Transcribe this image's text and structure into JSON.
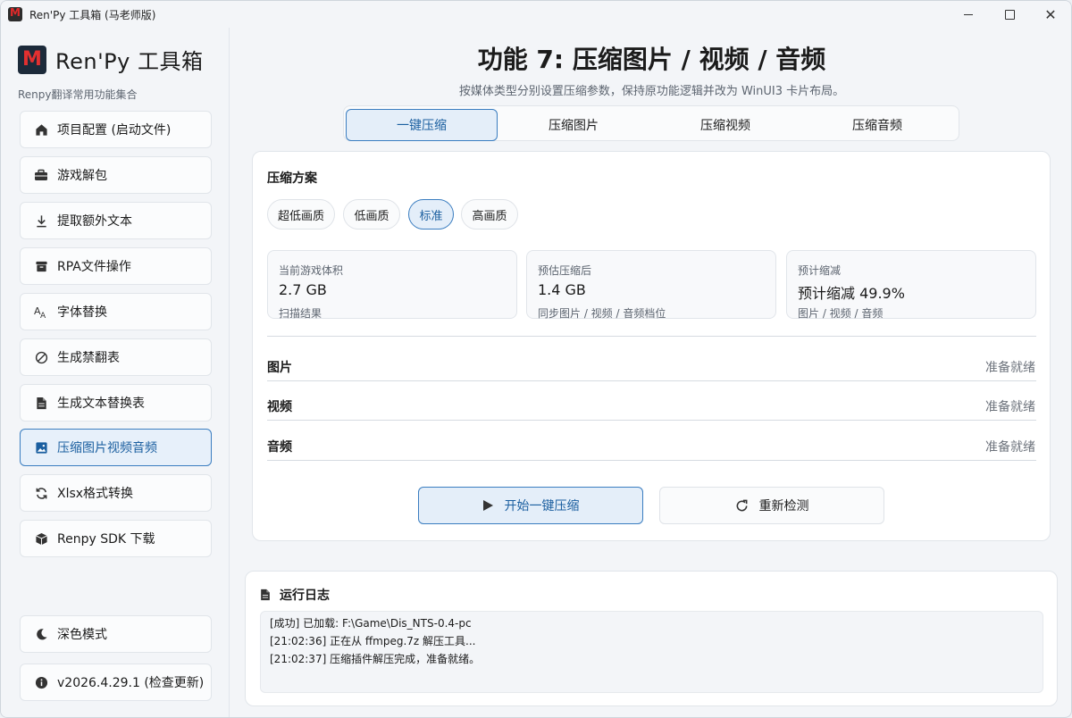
{
  "window": {
    "title": "Ren'Py 工具箱 (马老师版)",
    "controls": {
      "minimize": "—",
      "maximize": "☐",
      "close": "✕"
    }
  },
  "sidebar": {
    "brand_title": "Ren'Py 工具箱",
    "brand_logo_letter": "M",
    "brand_subtitle": "Renpy翻译常用功能集合",
    "items": [
      {
        "label": "项目配置 (启动文件)",
        "icon": "home-icon"
      },
      {
        "label": "游戏解包",
        "icon": "briefcase-icon"
      },
      {
        "label": "提取额外文本",
        "icon": "download-icon"
      },
      {
        "label": "RPA文件操作",
        "icon": "archive-icon"
      },
      {
        "label": "字体替换",
        "icon": "font-icon"
      },
      {
        "label": "生成禁翻表",
        "icon": "block-icon"
      },
      {
        "label": "生成文本替换表",
        "icon": "document-icon"
      },
      {
        "label": "压缩图片视频音频",
        "icon": "image-icon",
        "active": true
      },
      {
        "label": "Xlsx格式转换",
        "icon": "sync-icon"
      },
      {
        "label": "Renpy SDK 下载",
        "icon": "package-icon"
      }
    ],
    "dark_mode_label": "深色模式",
    "version_label": "v2026.4.29.1 (检查更新)"
  },
  "main": {
    "title": "功能 7: 压缩图片 / 视频 / 音频",
    "subtitle": "按媒体类型分别设置压缩参数，保持原功能逻辑并改为 WinUI3 卡片布局。",
    "tabs": [
      "一键压缩",
      "压缩图片",
      "压缩视频",
      "压缩音频"
    ],
    "active_tab": 0,
    "scheme_label": "压缩方案",
    "presets": [
      "超低画质",
      "低画质",
      "标准",
      "高画质"
    ],
    "active_preset": 2,
    "stats": [
      {
        "label": "当前游戏体积",
        "value": "2.7 GB",
        "note": "扫描结果"
      },
      {
        "label": "预估压缩后",
        "value": "1.4 GB",
        "note": "同步图片 / 视频 / 音频档位"
      },
      {
        "label": "预计缩减",
        "value": "预计缩减 49.9%",
        "note": "图片 / 视频 / 音频"
      }
    ],
    "rows": [
      {
        "label": "图片",
        "status": "准备就绪"
      },
      {
        "label": "视频",
        "status": "准备就绪"
      },
      {
        "label": "音频",
        "status": "准备就绪"
      }
    ],
    "start_button": "开始一键压缩",
    "recheck_button": "重新检测"
  },
  "log": {
    "title": "运行日志",
    "lines": [
      "[成功] 已加载: F:\\Game\\Dis_NTS-0.4-pc",
      "[21:02:36] 正在从 ffmpeg.7z 解压工具...",
      "[21:02:37] 压缩插件解压完成，准备就绪。"
    ]
  },
  "colors": {
    "accent": "#3a7dc0",
    "accent_text": "#1b5fa0",
    "active_bg": "#e4eef9"
  }
}
